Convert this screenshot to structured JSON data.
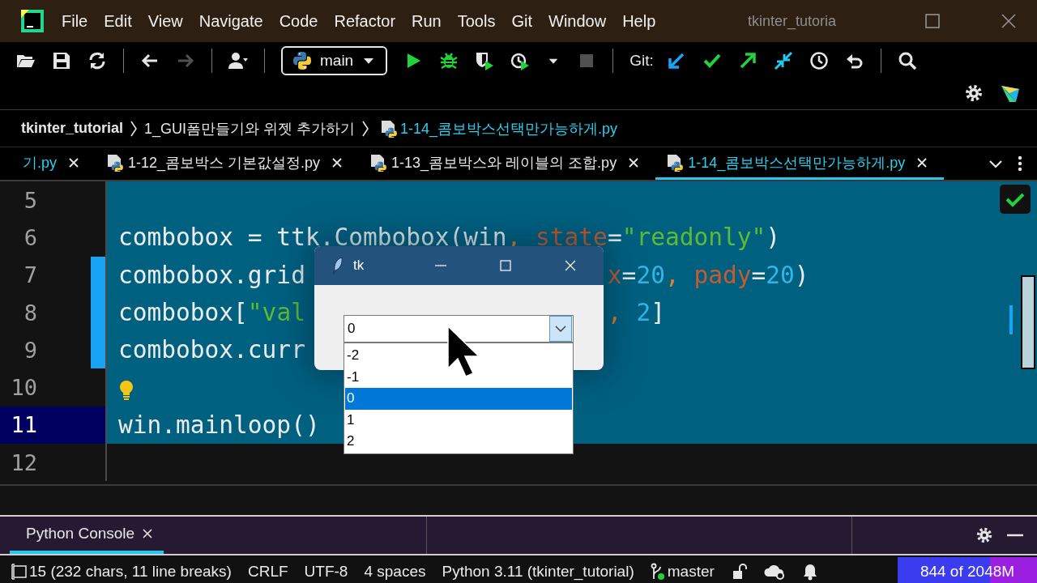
{
  "window": {
    "title": "tkinter_tutoria"
  },
  "menu": [
    {
      "label": "File"
    },
    {
      "label": "Edit"
    },
    {
      "label": "View"
    },
    {
      "label": "Navigate"
    },
    {
      "label": "Code"
    },
    {
      "label": "Refactor"
    },
    {
      "label": "Run"
    },
    {
      "label": "Tools"
    },
    {
      "label": "Git"
    },
    {
      "label": "Window"
    },
    {
      "label": "Help"
    }
  ],
  "toolbar": [
    {
      "kind": "open",
      "disabled": false
    },
    {
      "kind": "save",
      "disabled": false
    },
    {
      "kind": "sync",
      "disabled": false
    },
    {
      "kind": "separator"
    },
    {
      "kind": "back",
      "disabled": false
    },
    {
      "kind": "forward",
      "disabled": true
    },
    {
      "kind": "separator"
    },
    {
      "kind": "user",
      "disabled": false
    },
    {
      "kind": "separator"
    },
    {
      "kind": "config",
      "label": "main",
      "disabled": false
    },
    {
      "kind": "run",
      "disabled": false
    },
    {
      "kind": "debug",
      "disabled": false
    },
    {
      "kind": "coverage",
      "disabled": false
    },
    {
      "kind": "profile",
      "disabled": false
    },
    {
      "kind": "caret",
      "disabled": false
    },
    {
      "kind": "stop",
      "disabled": true
    },
    {
      "kind": "separator"
    },
    {
      "kind": "label",
      "label": "Git:"
    },
    {
      "kind": "update",
      "disabled": false
    },
    {
      "kind": "commit",
      "disabled": false
    },
    {
      "kind": "push",
      "disabled": false
    },
    {
      "kind": "merge",
      "disabled": false
    },
    {
      "kind": "history",
      "disabled": false
    },
    {
      "kind": "rollback",
      "disabled": false
    },
    {
      "kind": "separator"
    },
    {
      "kind": "search",
      "disabled": false
    }
  ],
  "breadcrumb": [
    {
      "label": "tkinter_tutorial",
      "kind": "project"
    },
    {
      "label": "1_GUI폼만들기와 위젯 추가하기",
      "kind": "folder"
    },
    {
      "label": "1-14_콤보박스선택만가능하게.py",
      "kind": "file"
    }
  ],
  "tabs": [
    {
      "label": "기.py",
      "selected": false,
      "icon": false
    },
    {
      "label": "1-12_콤보박스 기본값설정.py",
      "selected": false,
      "icon": true
    },
    {
      "label": "1-13_콤보박스와 레이블의 조합.py",
      "selected": false,
      "icon": true
    },
    {
      "label": "1-14_콤보박스선택만가능하게.py",
      "selected": true,
      "icon": true
    }
  ],
  "editor": {
    "lines": [
      {
        "number": "5",
        "selected": true,
        "current": false,
        "changed": false,
        "bulb": false
      },
      {
        "number": "6",
        "selected": true,
        "current": false,
        "changed": false,
        "bulb": false,
        "left": [
          {
            "text": "combobox = ttk.Combobox(win",
            "kind": "plain"
          },
          {
            "text": ", ",
            "kind": "comma"
          },
          {
            "text": "state",
            "kind": "param"
          },
          {
            "text": "=",
            "kind": "plain"
          },
          {
            "text": "\"readonly\"",
            "kind": "string"
          },
          {
            "text": ")",
            "kind": "plain"
          }
        ]
      },
      {
        "number": "7",
        "selected": true,
        "current": false,
        "changed": true,
        "bulb": false,
        "left": [
          {
            "text": "combobox.grid",
            "kind": "plain"
          }
        ],
        "right": [
          {
            "text": "x",
            "kind": "param"
          },
          {
            "text": "=",
            "kind": "plain"
          },
          {
            "text": "20",
            "kind": "number"
          },
          {
            "text": ", ",
            "kind": "comma"
          },
          {
            "text": "pady",
            "kind": "param"
          },
          {
            "text": "=",
            "kind": "plain"
          },
          {
            "text": "20",
            "kind": "number"
          },
          {
            "text": ")",
            "kind": "plain"
          }
        ]
      },
      {
        "number": "8",
        "selected": true,
        "current": false,
        "changed": true,
        "bulb": false,
        "left": [
          {
            "text": "combobox[",
            "kind": "plain"
          },
          {
            "text": "\"val",
            "kind": "string"
          }
        ],
        "right": [
          {
            "text": ", ",
            "kind": "comma"
          },
          {
            "text": "2",
            "kind": "number"
          },
          {
            "text": "]",
            "kind": "plain"
          }
        ]
      },
      {
        "number": "9",
        "selected": true,
        "current": false,
        "changed": true,
        "bulb": false,
        "left": [
          {
            "text": "combobox.curr",
            "kind": "plain"
          }
        ]
      },
      {
        "number": "10",
        "selected": true,
        "current": false,
        "changed": false,
        "bulb": true
      },
      {
        "number": "11",
        "selected": true,
        "current": true,
        "changed": false,
        "bulb": false,
        "left": [
          {
            "text": "win.mainloop()",
            "kind": "plain"
          }
        ]
      },
      {
        "number": "12",
        "selected": false,
        "current": false,
        "changed": false,
        "bulb": false
      }
    ]
  },
  "tk_window": {
    "title": "tk",
    "combobox": {
      "value": "0"
    },
    "options": [
      {
        "label": "-2",
        "selected": false
      },
      {
        "label": "-1",
        "selected": false
      },
      {
        "label": "0",
        "selected": true
      },
      {
        "label": "1",
        "selected": false
      },
      {
        "label": "2",
        "selected": false
      }
    ]
  },
  "tool_window": {
    "tabs": [
      {
        "label": "Python Console",
        "selected": true
      }
    ]
  },
  "status_bar": {
    "position": "15 (232 chars, 11 line breaks)",
    "line_separator": "CRLF",
    "encoding": "UTF-8",
    "indent": "4 spaces",
    "interpreter": "Python 3.11 (tkinter_tutorial)",
    "branch": "master",
    "memory": {
      "reading": "844 of 2048M",
      "level": 0.66
    }
  }
}
